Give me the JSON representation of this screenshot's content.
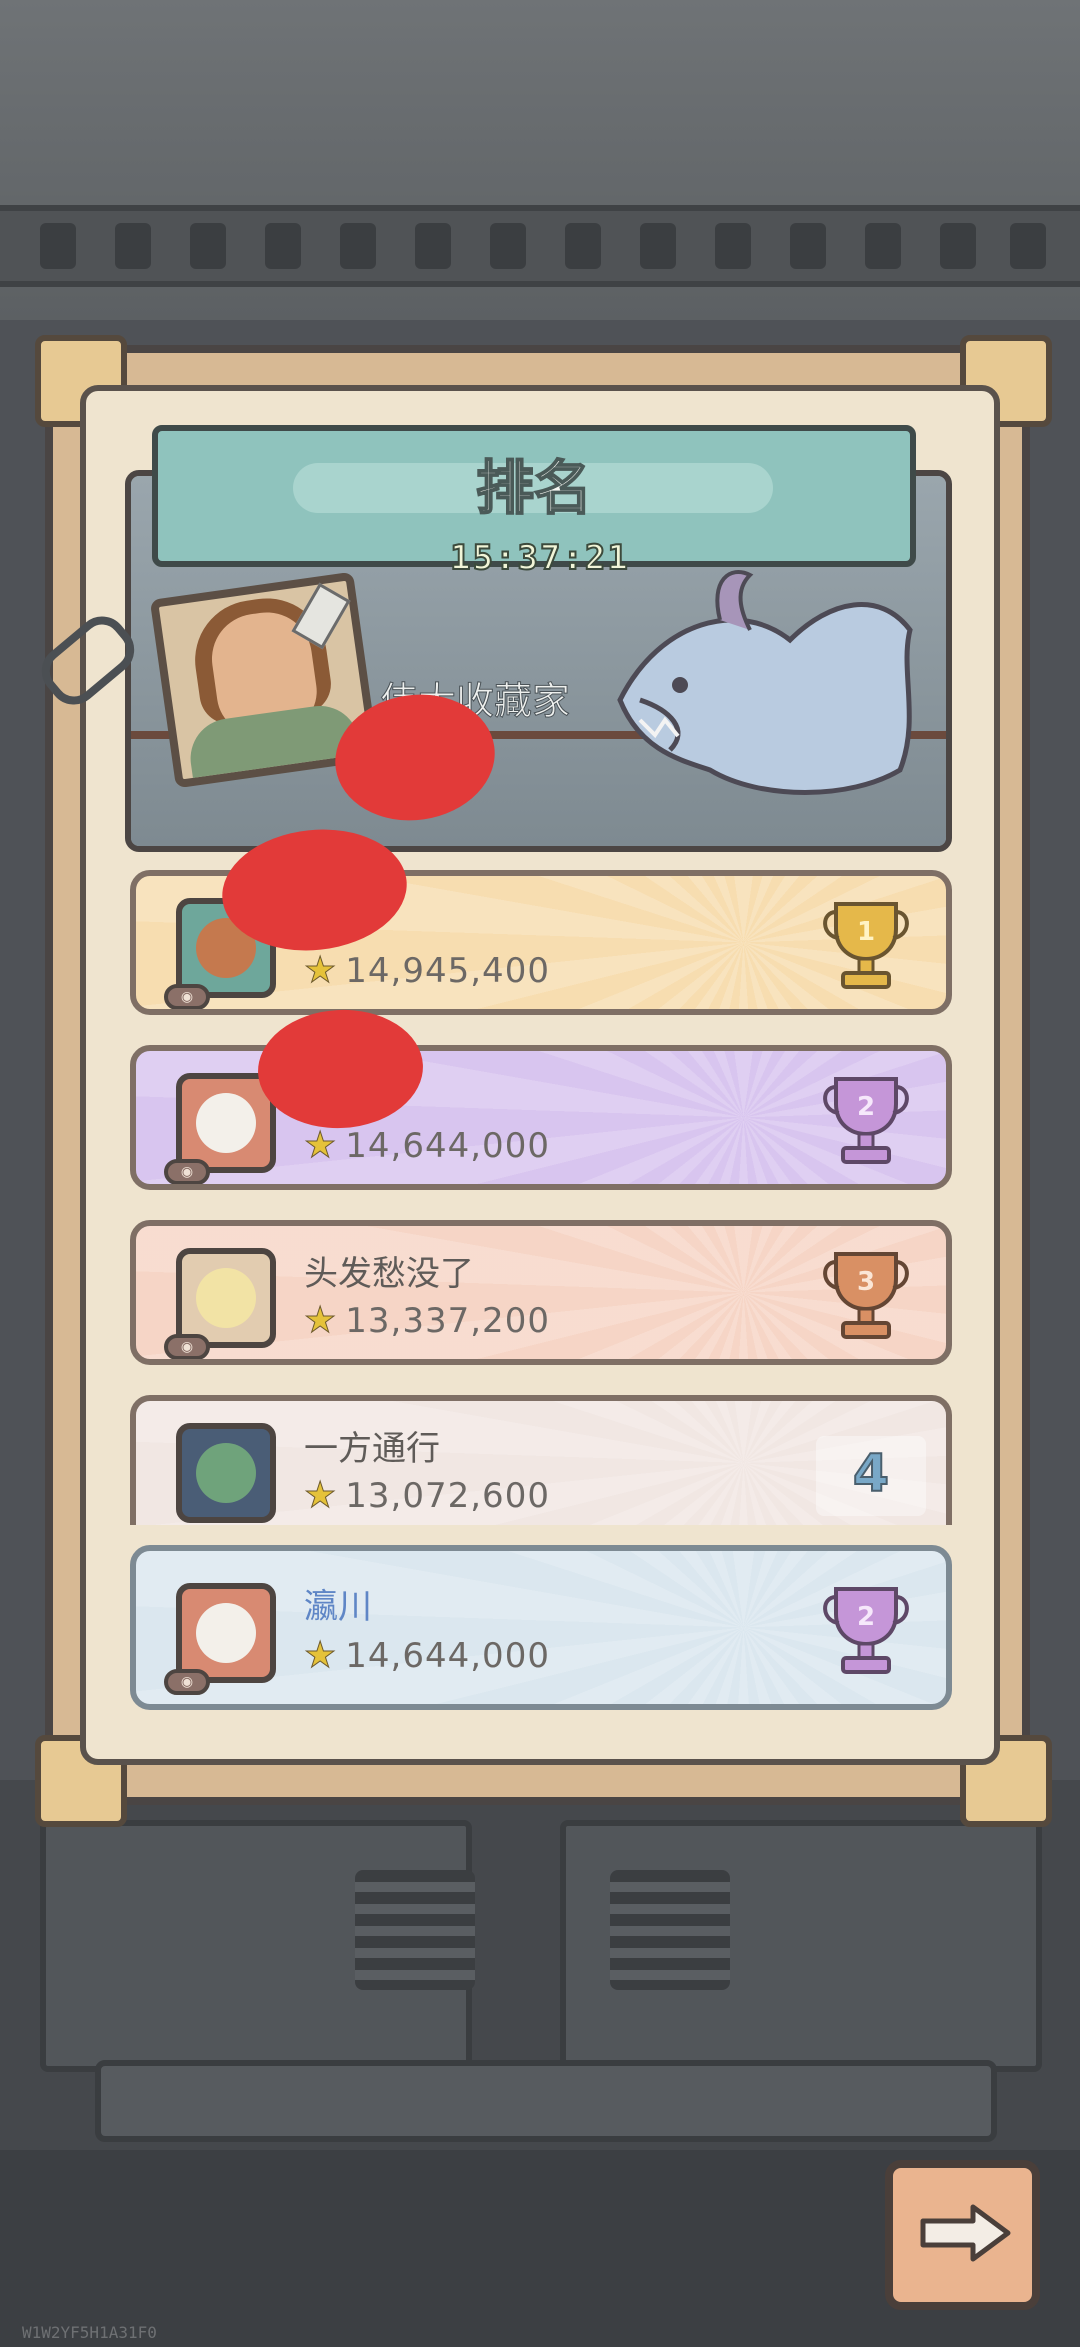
{
  "header": {
    "title": "排名",
    "timer": "15:37:21"
  },
  "banner": {
    "player_title": "伟大收藏家"
  },
  "rankings": [
    {
      "rank": "1",
      "name": "",
      "score": "14,945,400",
      "trophy": "gold-trophy-icon",
      "bg": "#f7ddb0",
      "avatar_color": "#6ea79b",
      "avatar_blob": "#c5794e"
    },
    {
      "rank": "2",
      "name": "",
      "score": "14,644,000",
      "trophy": "purple-trophy-icon",
      "bg": "#d8c5ef",
      "avatar_color": "#d88a72",
      "avatar_blob": "#f3f0ea"
    },
    {
      "rank": "3",
      "name": "头发愁没了",
      "score": "13,337,200",
      "trophy": "bronze-trophy-icon",
      "bg": "#f6d5c6",
      "avatar_color": "#e2ccb0",
      "avatar_blob": "#f2e3a5"
    },
    {
      "rank": "4",
      "name": "一方通行",
      "score": "13,072,600",
      "trophy": "",
      "bg": "#f1e7e3",
      "avatar_color": "#4a5d76",
      "avatar_blob": "#6fa37b"
    }
  ],
  "self_entry": {
    "rank": "2",
    "name": "瀛川",
    "score": "14,644,000",
    "trophy": "purple-trophy-icon",
    "bg": "#dbe7ef"
  },
  "buttons": {
    "next": "arrow-right-icon"
  },
  "watermark": "W1W2YF5H1A31F0"
}
